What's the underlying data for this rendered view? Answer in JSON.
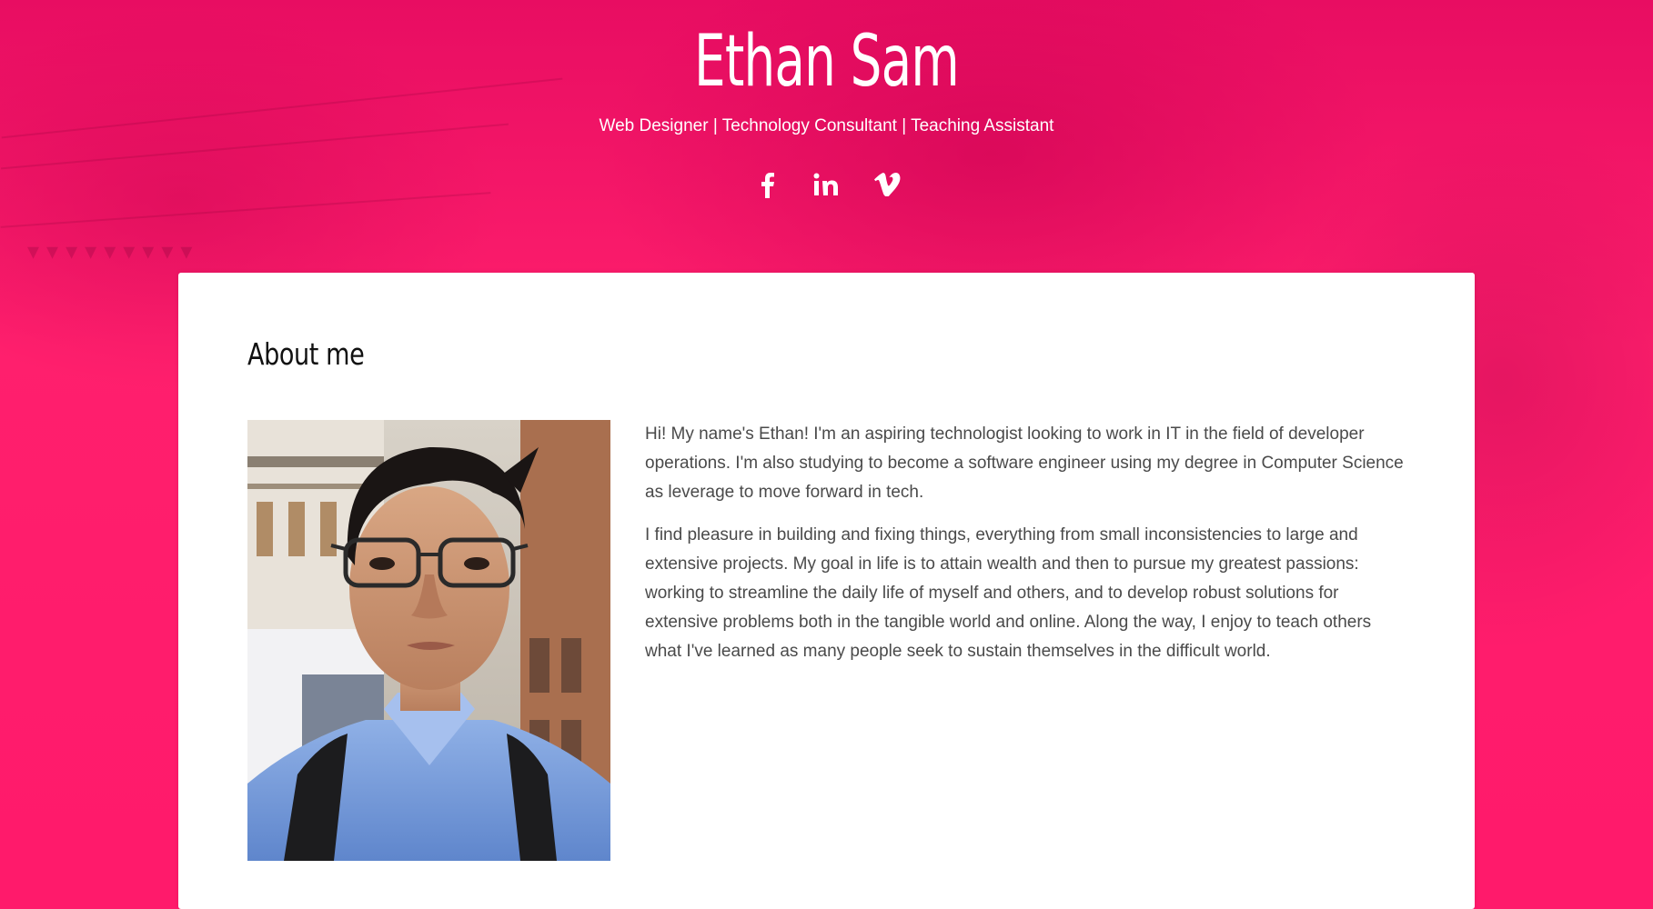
{
  "header": {
    "name": "Ethan Sam",
    "tagline": "Web Designer | Technology Consultant | Teaching Assistant",
    "social": [
      {
        "icon": "facebook-icon"
      },
      {
        "icon": "linkedin-icon"
      },
      {
        "icon": "vimeo-icon"
      }
    ]
  },
  "about": {
    "title": "About me",
    "paragraphs": [
      "Hi! My name's Ethan! I'm an aspiring technologist looking to work in IT in the field of developer operations. I'm also studying to become a software engineer using my degree in Computer Science as leverage to move forward in tech.",
      "I find pleasure in building and fixing things, everything from small inconsistencies to large and extensive projects. My goal in life is to attain wealth and then to pursue my greatest passions: working to streamline the daily life of myself and others, and to develop robust solutions for extensive problems both in the tangible world and online. Along the way, I enjoy to teach others what I've learned as many people seek to sustain themselves in the difficult world."
    ]
  },
  "colors": {
    "hero": "#ff1a6b",
    "hero_dark": "#e80d62",
    "card": "#ffffff",
    "heading": "#111111",
    "body_text": "#4a4a4a"
  }
}
